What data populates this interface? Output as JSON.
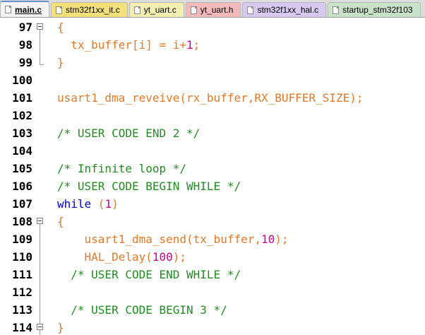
{
  "tabs": [
    {
      "label": "main.c",
      "color": "#dcdcdc",
      "active": true
    },
    {
      "label": "stm32f1xx_it.c",
      "color": "#f5e17a"
    },
    {
      "label": "yt_uart.c",
      "color": "#f2efb0"
    },
    {
      "label": "yt_uart.h",
      "color": "#f4b9b9"
    },
    {
      "label": "stm32f1xx_hal.c",
      "color": "#d7c9ef"
    },
    {
      "label": "startup_stm32f103",
      "color": "#c9e3c9"
    }
  ],
  "lines": [
    {
      "num": "97",
      "fold": true,
      "indent": "",
      "tokens": [
        {
          "t": "{",
          "c": "punct"
        }
      ]
    },
    {
      "num": "98",
      "indent": "  ",
      "tokens": [
        {
          "t": "tx_buffer[i] = i+",
          "c": "orange"
        },
        {
          "t": "1",
          "c": "num"
        },
        {
          "t": ";",
          "c": "orange"
        }
      ]
    },
    {
      "num": "99",
      "indent": "",
      "tokens": [
        {
          "t": "}",
          "c": "punct"
        }
      ]
    },
    {
      "num": "100",
      "indent": "",
      "tokens": []
    },
    {
      "num": "101",
      "indent": "",
      "tokens": [
        {
          "t": "usart1_dma_reveive(rx_buffer,RX_BUFFER_SIZE);",
          "c": "orange"
        }
      ]
    },
    {
      "num": "102",
      "indent": "",
      "tokens": []
    },
    {
      "num": "103",
      "indent": "",
      "tokens": [
        {
          "t": "/* USER CODE END 2 */",
          "c": "comment"
        }
      ]
    },
    {
      "num": "104",
      "indent": "",
      "tokens": []
    },
    {
      "num": "105",
      "indent": "",
      "tokens": [
        {
          "t": "/* Infinite loop */",
          "c": "comment"
        }
      ]
    },
    {
      "num": "106",
      "indent": "",
      "tokens": [
        {
          "t": "/* USER CODE BEGIN WHILE */",
          "c": "comment"
        }
      ]
    },
    {
      "num": "107",
      "indent": "",
      "tokens": [
        {
          "t": "while",
          "c": "kw"
        },
        {
          "t": " (",
          "c": "orange"
        },
        {
          "t": "1",
          "c": "num"
        },
        {
          "t": ")",
          "c": "orange"
        }
      ]
    },
    {
      "num": "108",
      "fold": true,
      "indent": "",
      "tokens": [
        {
          "t": "{",
          "c": "punct"
        }
      ]
    },
    {
      "num": "109",
      "indent": "    ",
      "tokens": [
        {
          "t": "usart1_dma_send(tx_buffer,",
          "c": "orange"
        },
        {
          "t": "10",
          "c": "num"
        },
        {
          "t": ");",
          "c": "orange"
        }
      ]
    },
    {
      "num": "110",
      "indent": "    ",
      "tokens": [
        {
          "t": "HAL_Delay(",
          "c": "orange"
        },
        {
          "t": "100",
          "c": "num"
        },
        {
          "t": ");",
          "c": "orange"
        }
      ]
    },
    {
      "num": "111",
      "indent": "  ",
      "tokens": [
        {
          "t": "/* USER CODE END WHILE */",
          "c": "comment"
        }
      ]
    },
    {
      "num": "112",
      "indent": "",
      "tokens": []
    },
    {
      "num": "113",
      "indent": "  ",
      "tokens": [
        {
          "t": "/* USER CODE BEGIN 3 */",
          "c": "comment"
        }
      ]
    },
    {
      "num": "114",
      "fold": true,
      "indent": "",
      "tokens": [
        {
          "t": "}",
          "c": "punct"
        }
      ]
    }
  ]
}
